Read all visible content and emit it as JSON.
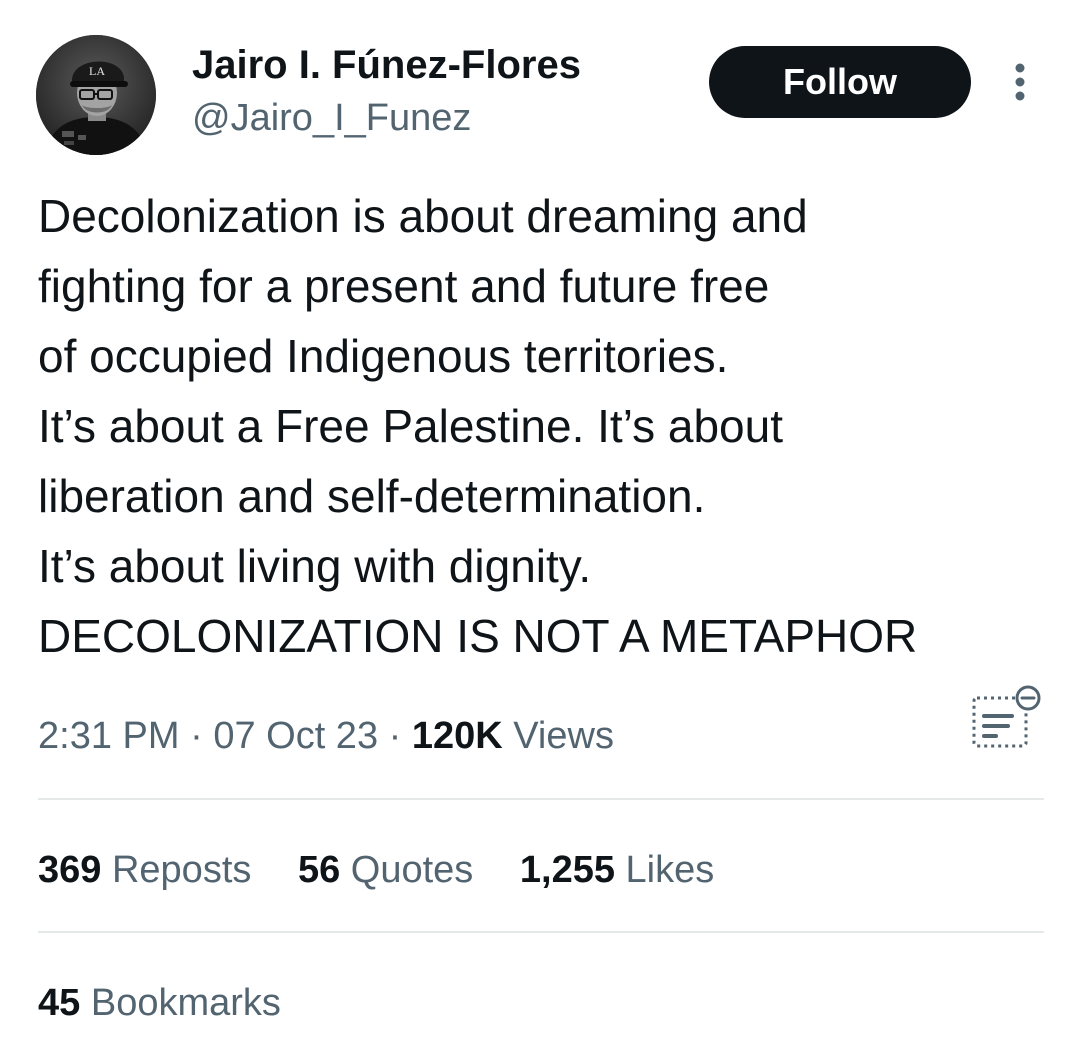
{
  "author": {
    "display_name": "Jairo I. Fúnez-Flores",
    "handle": "@Jairo_I_Funez",
    "avatar_icon": "profile-photo",
    "avatar_cap_text": "LA"
  },
  "header": {
    "follow_label": "Follow",
    "more_icon": "more-vertical-icon"
  },
  "tweet": {
    "lines": [
      "Decolonization is about dreaming and",
      "fighting for a present and future free",
      "of occupied Indigenous territories.",
      "It’s about a Free Palestine. It’s about",
      "liberation and self-determination.",
      "It’s about living with dignity.",
      "DECOLONIZATION IS NOT A METAPHOR"
    ]
  },
  "meta": {
    "time": "2:31 PM",
    "separator": "·",
    "date": "07 Oct 23",
    "views_count": "120K",
    "views_label": "Views",
    "analytics_icon": "post-analytics-icon"
  },
  "stats": {
    "reposts_count": "369",
    "reposts_label": "Reposts",
    "quotes_count": "56",
    "quotes_label": "Quotes",
    "likes_count": "1,255",
    "likes_label": "Likes",
    "bookmarks_count": "45",
    "bookmarks_label": "Bookmarks"
  },
  "colors": {
    "text_primary": "#0f1419",
    "text_secondary": "#536471",
    "button_bg": "#0f1419",
    "divider": "#e6e9ea"
  }
}
